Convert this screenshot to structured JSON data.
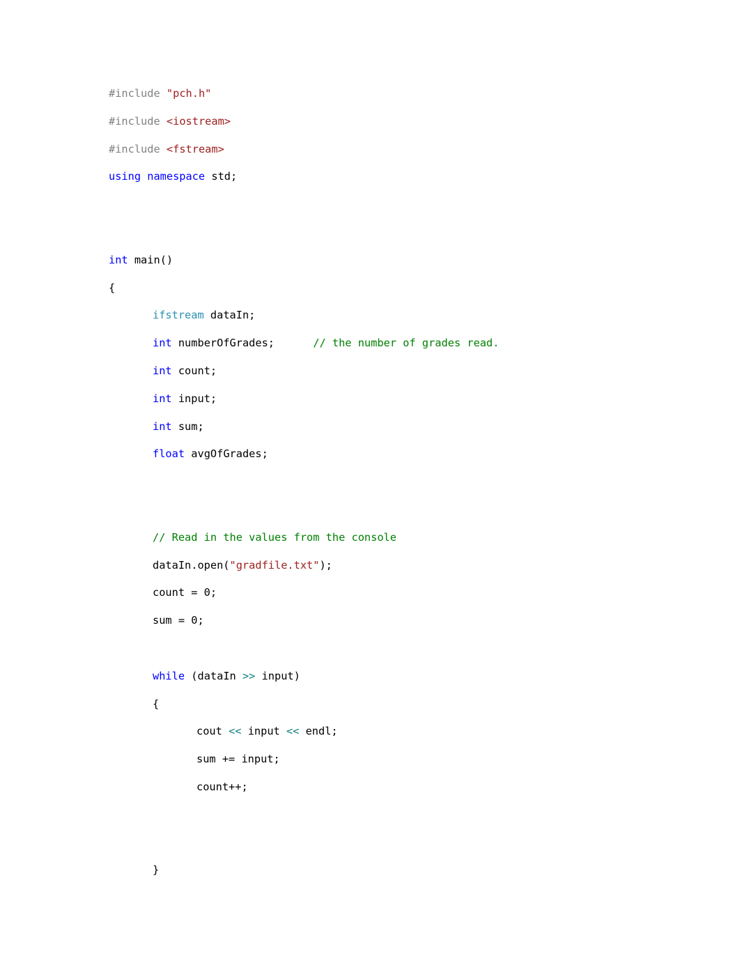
{
  "document": {
    "kind": "source-code-listing",
    "language": "C++",
    "background_color": "#ffffff",
    "text_color": "#000000"
  },
  "palette": {
    "preprocessor": "#808080",
    "string": "#a02020",
    "keyword": "#0000ff",
    "user_type": "#2b91af",
    "comment": "#008000",
    "operator": "#0f7f7f",
    "plain": "#000000"
  },
  "code": {
    "lines": [
      {
        "id": "l01",
        "indent": 0,
        "tokens": [
          {
            "t": "pre",
            "s": "#include"
          },
          {
            "t": "plain",
            "s": " "
          },
          {
            "t": "str",
            "s": "\"pch.h\""
          }
        ]
      },
      {
        "id": "l02",
        "indent": 0,
        "tokens": [
          {
            "t": "pre",
            "s": "#include"
          },
          {
            "t": "plain",
            "s": " "
          },
          {
            "t": "str",
            "s": "<iostream>"
          }
        ]
      },
      {
        "id": "l03",
        "indent": 0,
        "tokens": [
          {
            "t": "pre",
            "s": "#include"
          },
          {
            "t": "plain",
            "s": " "
          },
          {
            "t": "str",
            "s": "<fstream>"
          }
        ]
      },
      {
        "id": "l04",
        "indent": 0,
        "tokens": [
          {
            "t": "kw",
            "s": "using namespace"
          },
          {
            "t": "plain",
            "s": " std;"
          }
        ]
      },
      {
        "id": "l05",
        "indent": 0,
        "tokens": []
      },
      {
        "id": "l06",
        "indent": 0,
        "tokens": []
      },
      {
        "id": "l07",
        "indent": 0,
        "tokens": [
          {
            "t": "kw",
            "s": "int"
          },
          {
            "t": "plain",
            "s": " main()"
          }
        ]
      },
      {
        "id": "l08",
        "indent": 0,
        "tokens": [
          {
            "t": "plain",
            "s": "{"
          }
        ]
      },
      {
        "id": "l09",
        "indent": 1,
        "tokens": [
          {
            "t": "type",
            "s": "ifstream"
          },
          {
            "t": "plain",
            "s": " dataIn;"
          }
        ]
      },
      {
        "id": "l10",
        "indent": 1,
        "tokens": [
          {
            "t": "kw",
            "s": "int"
          },
          {
            "t": "plain",
            "s": " numberOfGrades;      "
          },
          {
            "t": "com",
            "s": "// the number of grades read."
          }
        ]
      },
      {
        "id": "l11",
        "indent": 1,
        "tokens": [
          {
            "t": "kw",
            "s": "int"
          },
          {
            "t": "plain",
            "s": " count;"
          }
        ]
      },
      {
        "id": "l12",
        "indent": 1,
        "tokens": [
          {
            "t": "kw",
            "s": "int"
          },
          {
            "t": "plain",
            "s": " input;"
          }
        ]
      },
      {
        "id": "l13",
        "indent": 1,
        "tokens": [
          {
            "t": "kw",
            "s": "int"
          },
          {
            "t": "plain",
            "s": " sum;"
          }
        ]
      },
      {
        "id": "l14",
        "indent": 1,
        "tokens": [
          {
            "t": "kw",
            "s": "float"
          },
          {
            "t": "plain",
            "s": " avgOfGrades;"
          }
        ]
      },
      {
        "id": "l15",
        "indent": 0,
        "tokens": []
      },
      {
        "id": "l16",
        "indent": 0,
        "tokens": []
      },
      {
        "id": "l17",
        "indent": 1,
        "tokens": [
          {
            "t": "com",
            "s": "// Read in the values from the console"
          }
        ]
      },
      {
        "id": "l18",
        "indent": 1,
        "tokens": [
          {
            "t": "plain",
            "s": "dataIn.open("
          },
          {
            "t": "str",
            "s": "\"gradfile.txt\""
          },
          {
            "t": "plain",
            "s": ");"
          }
        ]
      },
      {
        "id": "l19",
        "indent": 1,
        "tokens": [
          {
            "t": "plain",
            "s": "count = 0;"
          }
        ]
      },
      {
        "id": "l20",
        "indent": 1,
        "tokens": [
          {
            "t": "plain",
            "s": "sum = 0;"
          }
        ]
      },
      {
        "id": "l21",
        "indent": 0,
        "tokens": []
      },
      {
        "id": "l22",
        "indent": 1,
        "tokens": [
          {
            "t": "kw",
            "s": "while"
          },
          {
            "t": "plain",
            "s": " (dataIn "
          },
          {
            "t": "op",
            "s": ">>"
          },
          {
            "t": "plain",
            "s": " input)"
          }
        ]
      },
      {
        "id": "l23",
        "indent": 1,
        "tokens": [
          {
            "t": "plain",
            "s": "{"
          }
        ]
      },
      {
        "id": "l24",
        "indent": 2,
        "tokens": [
          {
            "t": "plain",
            "s": "cout "
          },
          {
            "t": "op",
            "s": "<<"
          },
          {
            "t": "plain",
            "s": " input "
          },
          {
            "t": "op",
            "s": "<<"
          },
          {
            "t": "plain",
            "s": " endl;"
          }
        ]
      },
      {
        "id": "l25",
        "indent": 2,
        "tokens": [
          {
            "t": "plain",
            "s": "sum += input;"
          }
        ]
      },
      {
        "id": "l26",
        "indent": 2,
        "tokens": [
          {
            "t": "plain",
            "s": "count++;"
          }
        ]
      },
      {
        "id": "l27",
        "indent": 0,
        "tokens": []
      },
      {
        "id": "l28",
        "indent": 0,
        "tokens": []
      },
      {
        "id": "l29",
        "indent": 1,
        "tokens": [
          {
            "t": "plain",
            "s": "}"
          }
        ]
      }
    ]
  }
}
